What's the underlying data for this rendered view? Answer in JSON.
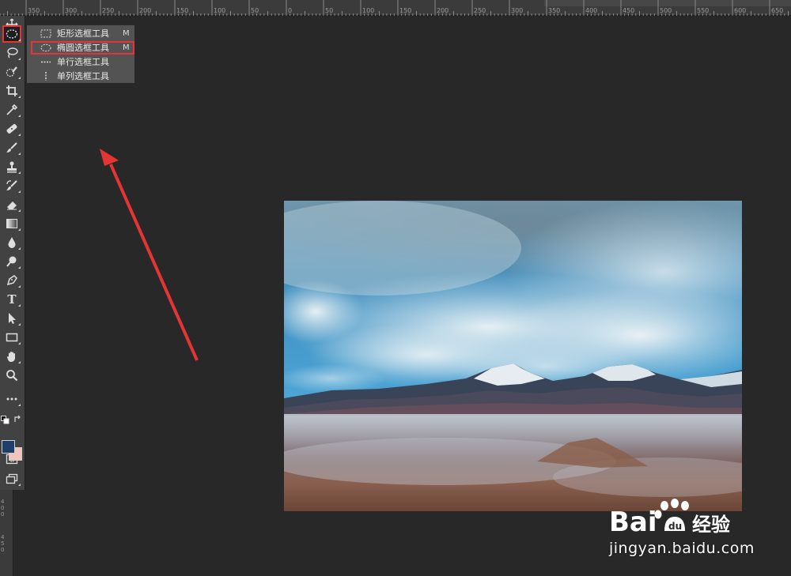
{
  "ruler": {
    "top_labels": [
      "350",
      "300",
      "250",
      "200",
      "150",
      "100",
      "50",
      "0",
      "50",
      "100",
      "150",
      "200",
      "250",
      "300",
      "350",
      "400",
      "450",
      "500",
      "550",
      "600",
      "650"
    ],
    "left_labels": [
      "4",
      "0",
      "0",
      "4",
      "5",
      "0"
    ]
  },
  "toolbar": {
    "tools": [
      {
        "name": "move-tool",
        "icon": "move-icon"
      },
      {
        "name": "elliptical-marquee-tool",
        "icon": "ellipse-marquee-icon",
        "active": true
      },
      {
        "name": "lasso-tool",
        "icon": "lasso-icon"
      },
      {
        "name": "quick-selection-tool",
        "icon": "quick-selection-icon"
      },
      {
        "name": "crop-tool",
        "icon": "crop-icon"
      },
      {
        "name": "eyedropper-tool",
        "icon": "eyedropper-icon"
      },
      {
        "name": "healing-brush-tool",
        "icon": "bandage-icon"
      },
      {
        "name": "brush-tool",
        "icon": "brush-icon"
      },
      {
        "name": "clone-stamp-tool",
        "icon": "stamp-icon"
      },
      {
        "name": "history-brush-tool",
        "icon": "history-brush-icon"
      },
      {
        "name": "eraser-tool",
        "icon": "eraser-icon"
      },
      {
        "name": "gradient-tool",
        "icon": "gradient-icon"
      },
      {
        "name": "blur-tool",
        "icon": "drop-icon"
      },
      {
        "name": "dodge-tool",
        "icon": "dodge-icon"
      },
      {
        "name": "pen-tool",
        "icon": "pen-icon"
      },
      {
        "name": "type-tool",
        "icon": "type-icon",
        "label": "T"
      },
      {
        "name": "path-selection-tool",
        "icon": "arrow-cursor-icon"
      },
      {
        "name": "rectangle-tool",
        "icon": "rectangle-icon"
      },
      {
        "name": "hand-tool",
        "icon": "hand-icon"
      },
      {
        "name": "zoom-tool",
        "icon": "zoom-icon"
      },
      {
        "name": "edit-toolbar",
        "icon": "more-icon"
      }
    ],
    "foreground_color": "#1f3f6b",
    "background_color": "#f2c4bd"
  },
  "flyout": {
    "items": [
      {
        "icon": "rect-marquee-icon",
        "label": "矩形选框工具",
        "shortcut": "M"
      },
      {
        "icon": "ellipse-marquee-icon",
        "label": "椭圆选框工具",
        "shortcut": "M",
        "highlight": true
      },
      {
        "icon": "single-row-marquee-icon",
        "label": "单行选框工具",
        "shortcut": ""
      },
      {
        "icon": "single-column-marquee-icon",
        "label": "单列选框工具",
        "shortcut": ""
      }
    ]
  },
  "annotation": {
    "color": "#e53434"
  },
  "watermark": {
    "brand": "Bai",
    "brand_suffix": "经验",
    "url": "jingyan.baidu.com"
  }
}
